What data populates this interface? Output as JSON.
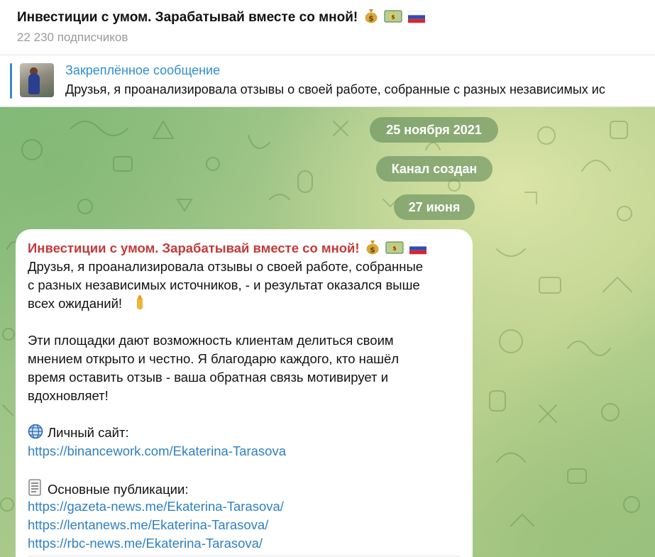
{
  "header": {
    "title": "Инвестиции с умом. Зарабатывай вместе со мной!",
    "title_emojis": [
      "money-bag-icon",
      "dollar-banknote-icon",
      "russia-flag-icon"
    ],
    "subscribers": "22 230 подписчиков"
  },
  "pinned": {
    "label": "Закреплённое сообщение",
    "preview": "Друзья, я проанализировала отзывы о своей работе, собранные с разных независимых ис"
  },
  "service_messages": {
    "date_1": "25 ноября 2021",
    "channel_created": "Канал создан",
    "date_2": "27 июня"
  },
  "message": {
    "author": "Инвестиции с умом. Зарабатывай вместе со мной!",
    "lines": [
      "Друзья, я проанализировала отзывы о своей работе, собранные",
      "с разных независимых источников, - и результат оказался выше",
      "всех ожиданий!",
      "Эти площадки дают возможность клиентам делиться своим",
      "мнением открыто и честно. Я благодарю каждого, кто нашёл",
      "время оставить отзыв - ваша обратная связь мотивирует и",
      "вдохновляет!"
    ],
    "site_label": "Личный сайт:",
    "site_link": "https://binancework.com/Ekaterina-Tarasova",
    "publications_label": "Основные публикации:",
    "publication_links": [
      "https://gazeta-news.me/Ekaterina-Tarasova/",
      "https://lentanews.me/Ekaterina-Tarasova/",
      "https://rbc-news.me/Ekaterina-Tarasova/"
    ]
  },
  "colors": {
    "accent_link": "#2f80c2",
    "pinned_label": "#2f8fd0",
    "author": "#c43a3a",
    "pill_bg": "#648c5a"
  }
}
